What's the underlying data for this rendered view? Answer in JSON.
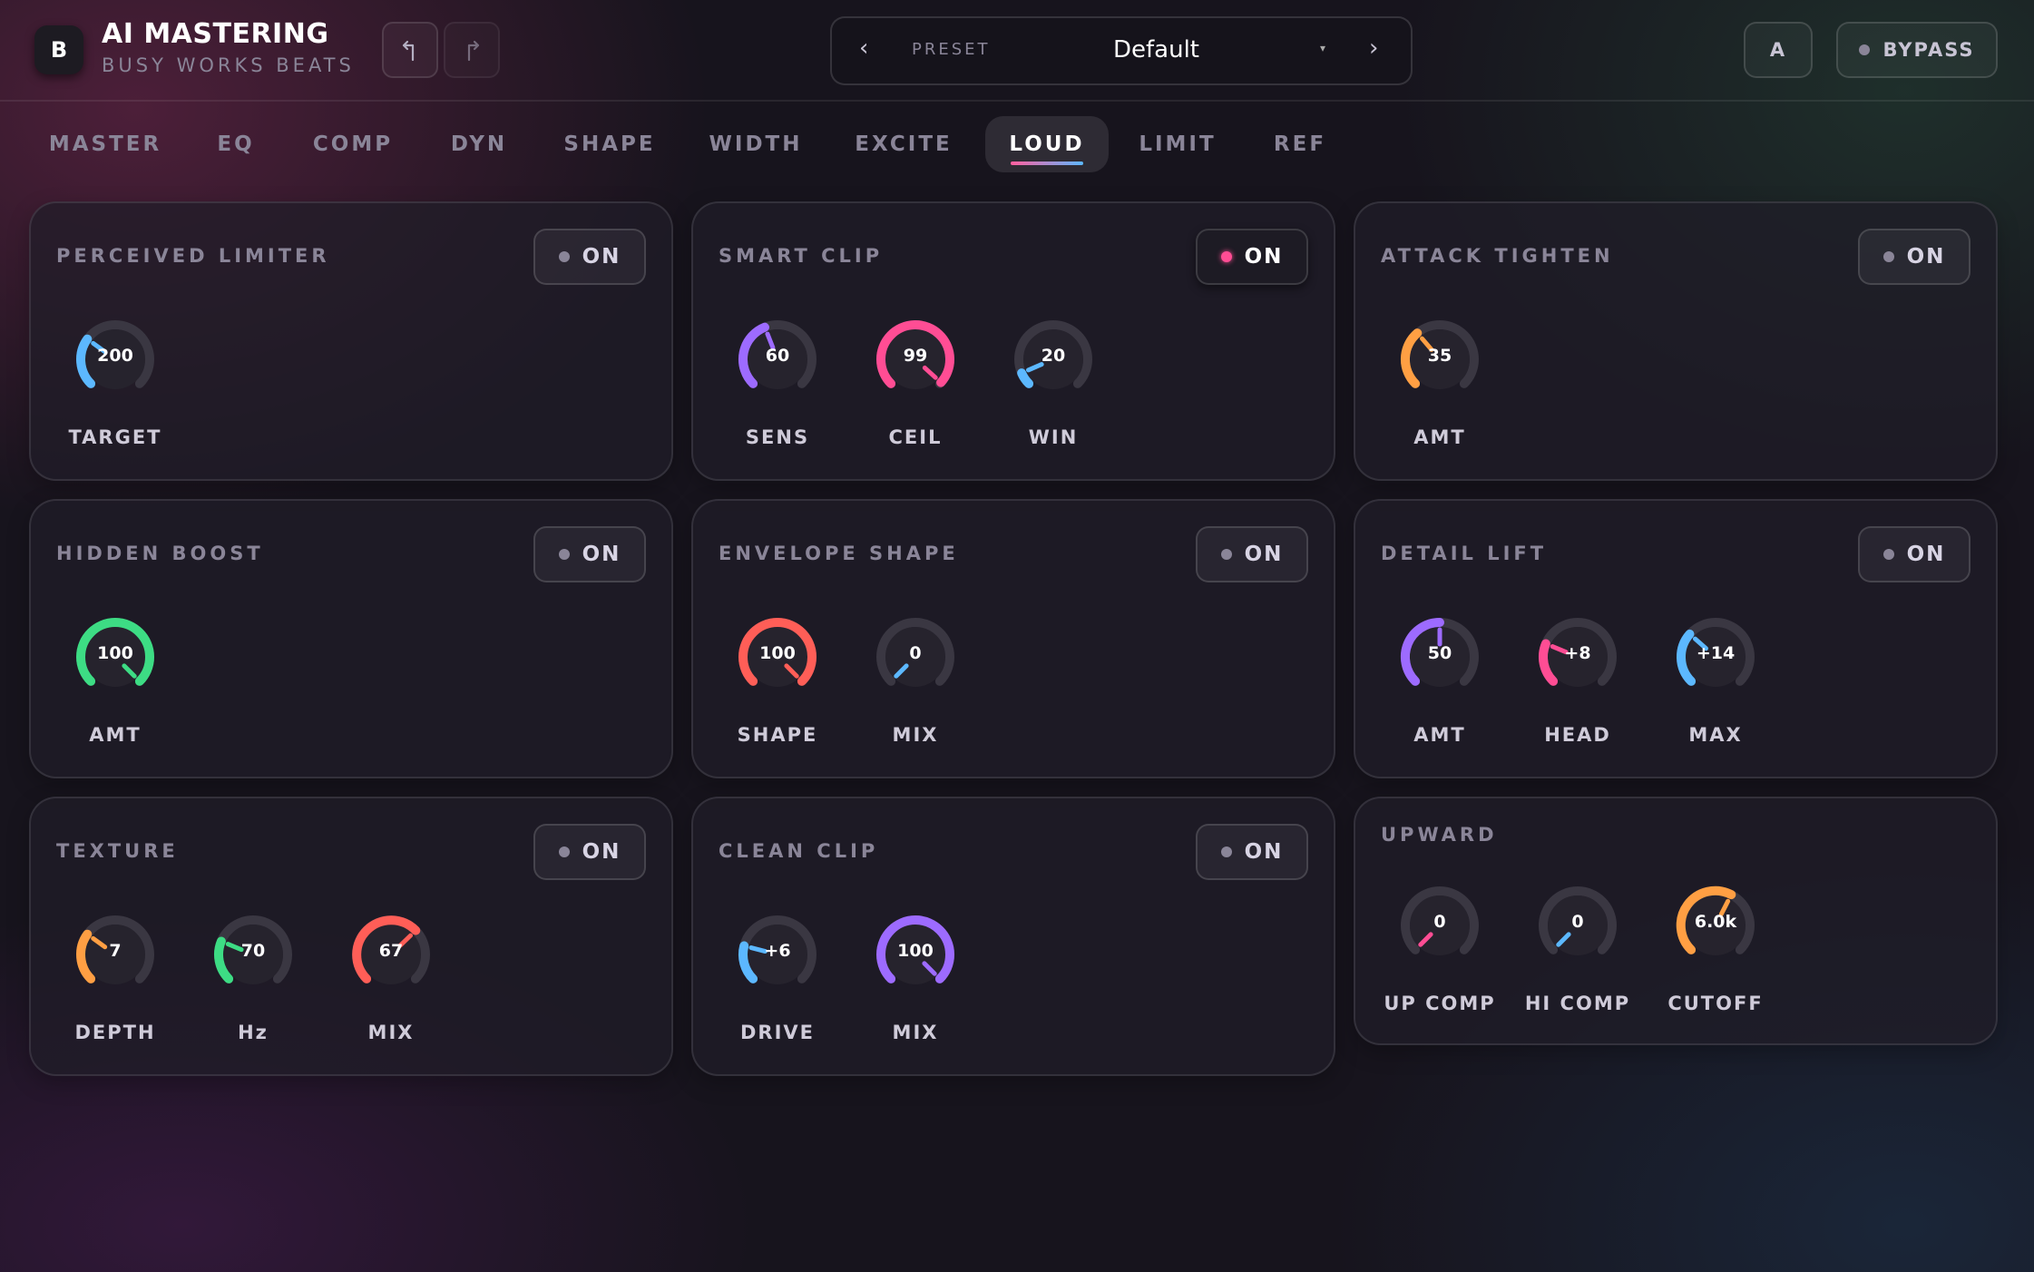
{
  "header": {
    "logo": "B",
    "title": "AI MASTERING",
    "subtitle": "BUSY WORKS BEATS",
    "undo_icon": "undo-icon",
    "redo_icon": "redo-icon",
    "preset_prev": "‹",
    "preset_label": "PRESET",
    "preset_value": "Default",
    "preset_caret": "▾",
    "preset_next": "›",
    "ab_label": "A",
    "bypass_label": "BYPASS"
  },
  "tabs": [
    {
      "label": "MASTER"
    },
    {
      "label": "EQ"
    },
    {
      "label": "COMP"
    },
    {
      "label": "DYN"
    },
    {
      "label": "SHAPE"
    },
    {
      "label": "WIDTH"
    },
    {
      "label": "EXCITE"
    },
    {
      "label": "LOUD"
    },
    {
      "label": "LIMIT"
    },
    {
      "label": "REF"
    }
  ],
  "active_tab": "LOUD",
  "colors": {
    "blue": "#5cb8ff",
    "purple": "#9d6bff",
    "pink": "#ff4d94",
    "orange": "#ff9f43",
    "green": "#3ddc84",
    "coral": "#ff5e57",
    "track": "#3a3742",
    "accent_on": "#ff4d94"
  },
  "cards": [
    {
      "title": "PERCEIVED LIMITER",
      "toggle": "ON",
      "toggle_active": false,
      "knobs": [
        {
          "value": "200",
          "label": "TARGET",
          "color": "blue",
          "level": 0.3
        }
      ]
    },
    {
      "title": "SMART CLIP",
      "toggle": "ON",
      "toggle_active": true,
      "knobs": [
        {
          "value": "60",
          "label": "SENS",
          "color": "purple",
          "level": 0.42
        },
        {
          "value": "99",
          "label": "CEIL",
          "color": "pink",
          "level": 0.99
        },
        {
          "value": "20",
          "label": "WIN",
          "color": "blue",
          "level": 0.08
        }
      ]
    },
    {
      "title": "ATTACK TIGHTEN",
      "toggle": "ON",
      "toggle_active": false,
      "knobs": [
        {
          "value": "35",
          "label": "AMT",
          "color": "orange",
          "level": 0.35
        }
      ]
    },
    {
      "title": "HIDDEN BOOST",
      "toggle": "ON",
      "toggle_active": false,
      "knobs": [
        {
          "value": "100",
          "label": "AMT",
          "color": "green",
          "level": 1.0
        }
      ]
    },
    {
      "title": "ENVELOPE SHAPE",
      "toggle": "ON",
      "toggle_active": false,
      "knobs": [
        {
          "value": "100",
          "label": "SHAPE",
          "color": "coral",
          "level": 1.0
        },
        {
          "value": "0",
          "label": "MIX",
          "color": "blue",
          "level": 0.0
        }
      ]
    },
    {
      "title": "DETAIL LIFT",
      "toggle": "ON",
      "toggle_active": false,
      "knobs": [
        {
          "value": "50",
          "label": "AMT",
          "color": "purple",
          "level": 0.5
        },
        {
          "value": "+8",
          "label": "HEAD",
          "color": "pink",
          "level": 0.25
        },
        {
          "value": "+14",
          "label": "MAX",
          "color": "blue",
          "level": 0.32
        }
      ]
    },
    {
      "title": "TEXTURE",
      "toggle": "ON",
      "toggle_active": false,
      "knobs": [
        {
          "value": "7",
          "label": "DEPTH",
          "color": "orange",
          "level": 0.3
        },
        {
          "value": "70",
          "label": "Hz",
          "color": "green",
          "level": 0.25
        },
        {
          "value": "67",
          "label": "MIX",
          "color": "coral",
          "level": 0.67
        }
      ]
    },
    {
      "title": "CLEAN CLIP",
      "toggle": "ON",
      "toggle_active": false,
      "knobs": [
        {
          "value": "+6",
          "label": "DRIVE",
          "color": "blue",
          "level": 0.22
        },
        {
          "value": "100",
          "label": "MIX",
          "color": "purple",
          "level": 1.0
        }
      ]
    },
    {
      "title": "UPWARD",
      "toggle": "",
      "toggle_active": false,
      "knobs": [
        {
          "value": "0",
          "label": "UP COMP",
          "color": "pink",
          "level": 0.0
        },
        {
          "value": "0",
          "label": "HI COMP",
          "color": "blue",
          "level": 0.0
        },
        {
          "value": "6.0k",
          "label": "CUTOFF",
          "color": "orange",
          "level": 0.6
        }
      ]
    }
  ]
}
